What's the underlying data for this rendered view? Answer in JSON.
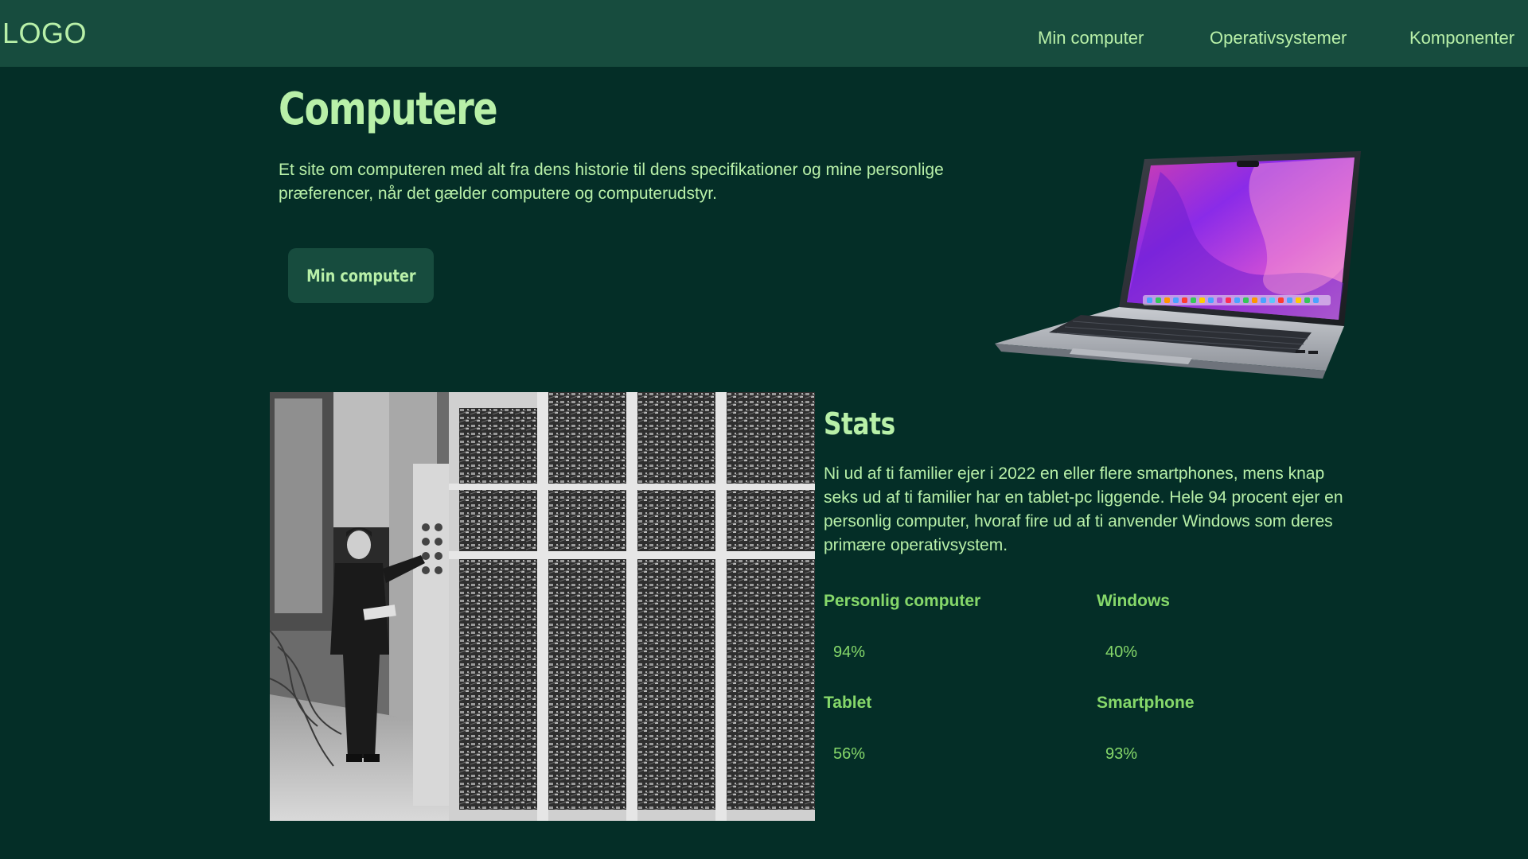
{
  "header": {
    "logo": "LOGO",
    "nav": [
      "Min computer",
      "Operativsystemer",
      "Komponenter"
    ]
  },
  "hero": {
    "title": "Computere",
    "description": "Et site om computeren med alt fra dens historie til dens specifikationer og mine personlige præferencer, når det gælder computere og computerudstyr.",
    "button_label": "Min computer"
  },
  "stats": {
    "title": "Stats",
    "text": "Ni ud af ti familier ejer i 2022 en eller flere smartphones, mens knap seks ud af ti familier har en tablet-pc liggende. Hele 94 procent ejer en personlig computer, hvoraf fire ud af ti anvender Windows som deres primære operativsystem.",
    "items": [
      {
        "label": "Personlig computer",
        "value": "94%"
      },
      {
        "label": "Windows",
        "value": "40%"
      },
      {
        "label": "Tablet",
        "value": "56%"
      },
      {
        "label": "Smartphone",
        "value": "93%"
      }
    ]
  },
  "colors": {
    "background": "#042e27",
    "header": "#174c3e",
    "text": "#b8f0a8",
    "accent": "#86d86a"
  }
}
